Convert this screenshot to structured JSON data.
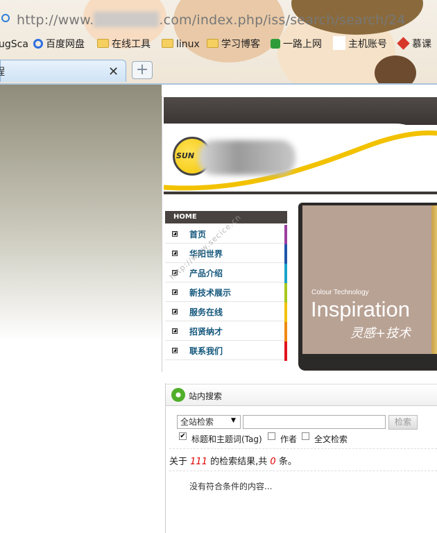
{
  "browser": {
    "url_prefix": "http://www.",
    "url_suffix": ".com/index.php/iss/search/search/24",
    "bookmarks": [
      {
        "label": "ugSca",
        "icon": "none"
      },
      {
        "label": "百度网盘",
        "icon": "baidu-icon"
      },
      {
        "label": "在线工具",
        "icon": "folder-icon"
      },
      {
        "label": "linux",
        "icon": "folder-icon"
      },
      {
        "label": "学习博客",
        "icon": "folder-icon"
      },
      {
        "label": "一路上网",
        "icon": "green-icon"
      },
      {
        "label": "主机账号",
        "icon": "page-icon"
      },
      {
        "label": "慕课",
        "icon": "red-icon"
      }
    ],
    "tab_title": "程",
    "tab_close": "✕",
    "new_tab": "+"
  },
  "site": {
    "logo_text": "SUN",
    "nav_home": "HOME",
    "nav_items": [
      "首页",
      "华阳世界",
      "产品介绍",
      "新技术展示",
      "服务在线",
      "招贤纳才",
      "联系我们"
    ],
    "nav_colors": [
      "#9b3fa0",
      "#1f56a8",
      "#19a3c9",
      "#a8c81c",
      "#f2c20c",
      "#f08a12",
      "#e0141c"
    ],
    "watermark": "http://www.secice.cn",
    "banner": {
      "small": "Colour Technology",
      "big": "Inspiration",
      "cn": "灵感+技术"
    }
  },
  "search": {
    "title": "站内搜索",
    "scope": "全站检索",
    "keyword": "",
    "button": "检索",
    "options": [
      {
        "label": "标题和主题词(Tag)",
        "checked": true
      },
      {
        "label": "作者",
        "checked": false
      },
      {
        "label": "全文检索",
        "checked": false
      }
    ],
    "result_prefix": "关于",
    "result_count": "111",
    "result_middle": "的检索结果,共",
    "result_total": "0",
    "result_suffix": "条。",
    "empty_message": "没有符合条件的内容..."
  }
}
